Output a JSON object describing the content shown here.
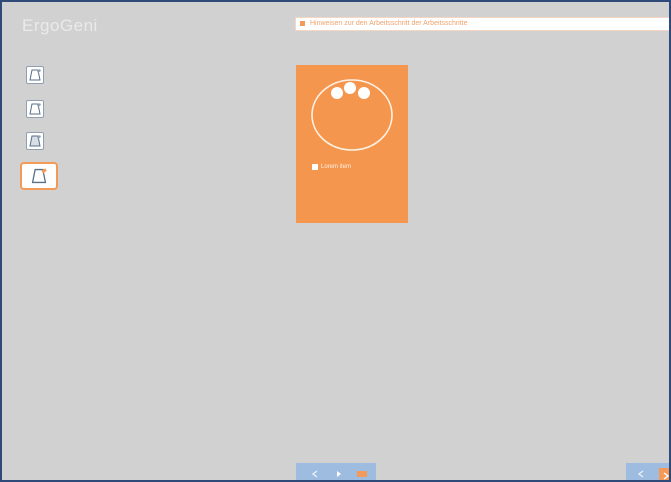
{
  "app": {
    "title": "ErgoGeni"
  },
  "notice": {
    "text": "Hinweisen zur den Arbeitsschritt der Arbeitsschritte"
  },
  "sidebar": {
    "items": [
      {
        "icon": "document-edit-icon"
      },
      {
        "icon": "document-edit-icon"
      },
      {
        "icon": "document-edit-icon"
      },
      {
        "icon": "document-edit-icon",
        "selected": true
      }
    ]
  },
  "preview": {
    "item_label": "Lorem item",
    "accent_color": "#f5964f"
  },
  "bottom_bar": {
    "buttons": [
      "prev-icon",
      "next-icon",
      "stop-icon"
    ]
  },
  "colors": {
    "frame": "#2f4a78",
    "background": "#d1d1d1",
    "accent": "#f39a58",
    "toolbar": "#9dbce0"
  }
}
